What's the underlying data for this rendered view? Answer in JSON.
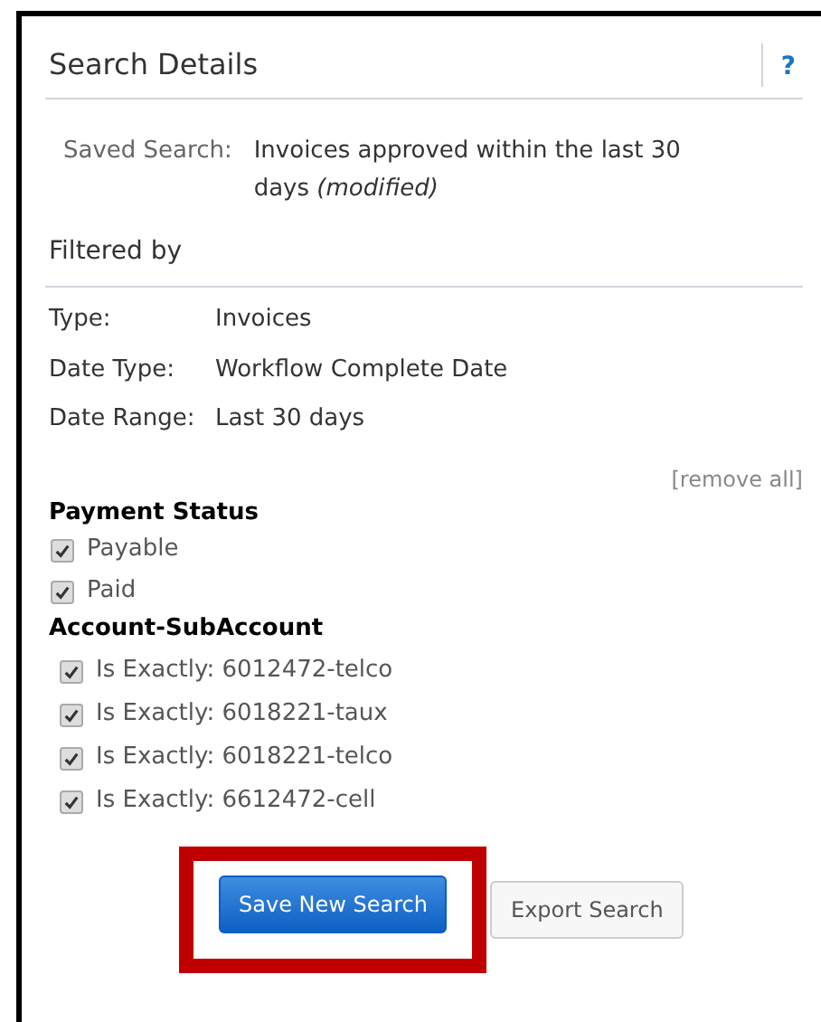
{
  "panel": {
    "title": "Search Details",
    "help": "?"
  },
  "saved_search": {
    "label": "Saved Search:",
    "value": "Invoices approved within the last 30 days *(modified)*"
  },
  "filtered_by": {
    "title": "Filtered by",
    "rows": [
      {
        "label": "Type:",
        "value": "Invoices"
      },
      {
        "label": "Date Type:",
        "value": "Workflow Complete Date"
      },
      {
        "label": "Date Range:",
        "value": "Last 30 days"
      }
    ],
    "remove_all": "[remove all]"
  },
  "groups": [
    {
      "title": "Payment Status",
      "items": [
        {
          "label": "Payable",
          "checked": true
        },
        {
          "label": "Paid",
          "checked": true
        }
      ]
    },
    {
      "title": "Account-SubAccount",
      "items": [
        {
          "label": "Is Exactly: 6012472-telco",
          "checked": true
        },
        {
          "label": "Is Exactly: 6018221-taux",
          "checked": true
        },
        {
          "label": "Is Exactly: 6018221-telco",
          "checked": true
        },
        {
          "label": "Is Exactly: 6612472-cell",
          "checked": true
        }
      ]
    }
  ],
  "buttons": [
    {
      "label": "Save New Search",
      "kind": "primary",
      "highlighted": true
    },
    {
      "label": "Export Search",
      "kind": "secondary",
      "highlighted": false
    }
  ]
}
